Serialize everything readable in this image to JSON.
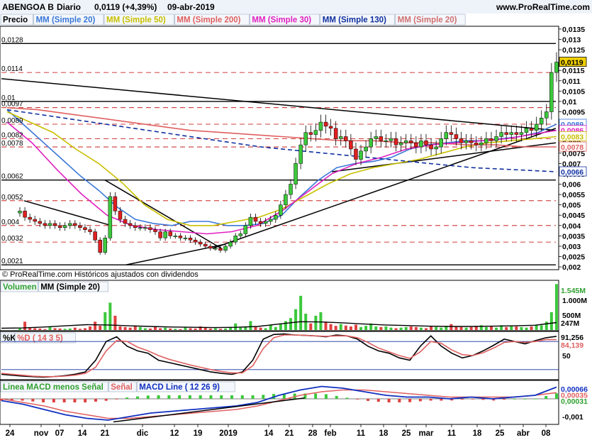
{
  "header": {
    "symbol": "ABENGOA B",
    "period": "Diario",
    "last": "0,0119 (+4,39%)",
    "date": "09-abr-2019",
    "site": "www.ProRealTime.com"
  },
  "main_legend": [
    {
      "label": "Precio",
      "color": "#000000"
    },
    {
      "label": "MM (Simple 20)",
      "color": "#3a78d8"
    },
    {
      "label": "MM (Simple 50)",
      "color": "#c8c000"
    },
    {
      "label": "MM (Simple 200)",
      "color": "#e06060"
    },
    {
      "label": "MM (Simple 30)",
      "color": "#e020c0"
    },
    {
      "label": "MM (Simple 130)",
      "color": "#1030a0"
    },
    {
      "label": "MM (Simple 20)",
      "color": "#d07070"
    }
  ],
  "footer_note": "© ProRealTime.com  Históricos ajustados con dividendos",
  "volume_legend": [
    {
      "label": "Volumen",
      "color": "#30a030"
    },
    {
      "label": "MM (Simple 20)",
      "color": "#000000"
    }
  ],
  "stoch_legend": [
    {
      "label": "%K",
      "color": "#000000"
    },
    {
      "label": "%D ( 14 3 5)",
      "color": "#e06060"
    }
  ],
  "macd_legend": [
    {
      "label": "Linea MACD menos Señal",
      "color": "#30a030"
    },
    {
      "label": "Señal",
      "color": "#e06060"
    },
    {
      "label": "MACD Line ( 12 26 9)",
      "color": "#1030c0"
    }
  ],
  "x_labels": [
    "24",
    "nov",
    "07",
    "14",
    "21",
    "dic",
    "12",
    "19",
    "2019",
    "14",
    "21",
    "28",
    "feb",
    "11",
    "18",
    "25",
    "mar",
    "11",
    "18",
    "25",
    "abr",
    "08"
  ],
  "price_axis_ticks": [
    "0,0135",
    "0,013",
    "0,0125",
    "0,012",
    "0,0115",
    "0,011",
    "0,0105",
    "0,01",
    "0,0095",
    "0,009",
    "0,0085",
    "0,008",
    "0,0075",
    "0,007",
    "0,0065",
    "0,006",
    "0,0055",
    "0,005",
    "0,0045",
    "0,004",
    "0,0035",
    "0,003",
    "0,0025",
    "0,002"
  ],
  "price_left_levels": [
    "0,0128",
    "0,0114",
    "0,01",
    "0,0097",
    "0,0089",
    "0,0082",
    "0,0078",
    "0,0062",
    "0,0052",
    "0,004",
    "0,0032",
    "0,0021"
  ],
  "price_badges": [
    {
      "text": "0,0119",
      "bg": "#f0d000",
      "fg": "#000000"
    },
    {
      "text": "0,0089",
      "bg": "#ffffff",
      "fg": "#3a78d8"
    },
    {
      "text": "0,0086",
      "bg": "#ffffff",
      "fg": "#e020c0"
    },
    {
      "text": "0,0083",
      "bg": "#ffffff",
      "fg": "#c8c000"
    },
    {
      "text": "0,0078",
      "bg": "#ffffff",
      "fg": "#e06060"
    },
    {
      "text": "0,0066",
      "bg": "#ffffff",
      "fg": "#1030a0"
    }
  ],
  "volume_axis": [
    "1.000M",
    "500M"
  ],
  "volume_badges": [
    {
      "text": "1.545M",
      "fg": "#30a030"
    },
    {
      "text": "247M",
      "fg": "#000000"
    }
  ],
  "stoch_axis": [
    "50"
  ],
  "stoch_badges": [
    {
      "text": "91,256",
      "fg": "#000000"
    },
    {
      "text": "84,139",
      "fg": "#e06060"
    }
  ],
  "macd_axis": [
    "-0,001"
  ],
  "macd_badges": [
    {
      "text": "0,00066",
      "fg": "#1030c0"
    },
    {
      "text": "0,00035",
      "fg": "#e06060"
    },
    {
      "text": "0,00031",
      "fg": "#30a030"
    }
  ],
  "chart_data": {
    "type": "candlestick",
    "series": [
      {
        "name": "Precio",
        "close": [
          0.0047,
          0.0044,
          0.0043,
          0.0042,
          0.0041,
          0.004,
          0.0041,
          0.004,
          0.0039,
          0.004,
          0.0041,
          0.004,
          0.0039,
          0.0038,
          0.0037,
          0.0033,
          0.0027,
          0.0034,
          0.0054,
          0.0047,
          0.0043,
          0.0041,
          0.004,
          0.0039,
          0.0039,
          0.0039,
          0.0038,
          0.0037,
          0.0034,
          0.0037,
          0.0035,
          0.0035,
          0.0034,
          0.0034,
          0.0033,
          0.0032,
          0.0031,
          0.003,
          0.0029,
          0.0029,
          0.0028,
          0.003,
          0.0032,
          0.0035,
          0.0036,
          0.004,
          0.0044,
          0.0042,
          0.0041,
          0.0042,
          0.0043,
          0.0045,
          0.005,
          0.0055,
          0.006,
          0.007,
          0.0079,
          0.0085,
          0.0084,
          0.0086,
          0.009,
          0.0088,
          0.0087,
          0.0082,
          0.0083,
          0.0081,
          0.0077,
          0.0072,
          0.0076,
          0.0078,
          0.0082,
          0.0083,
          0.0081,
          0.0081,
          0.0082,
          0.0079,
          0.008,
          0.0081,
          0.008,
          0.0078,
          0.0081,
          0.0079,
          0.0077,
          0.0078,
          0.0082,
          0.0085,
          0.0084,
          0.0082,
          0.008,
          0.0081,
          0.008,
          0.0079,
          0.008,
          0.0082,
          0.0081,
          0.0083,
          0.0085,
          0.0084,
          0.0085,
          0.0084,
          0.0085,
          0.0087,
          0.0086,
          0.0089,
          0.0092,
          0.0095,
          0.0114,
          0.0119
        ]
      },
      {
        "name": "MM (Simple 20)",
        "values": [
          0.0096,
          0.0088,
          0.008,
          0.0072,
          0.0064,
          0.0057,
          0.0049,
          0.0043,
          0.0041,
          0.004,
          0.0042,
          0.0042,
          0.004,
          0.004,
          0.0041,
          0.0045,
          0.0054,
          0.0062,
          0.0068,
          0.007,
          0.0071,
          0.0073,
          0.0077,
          0.0079,
          0.008,
          0.0081,
          0.0081,
          0.0082,
          0.0083,
          0.0085,
          0.0089
        ]
      },
      {
        "name": "MM (Simple 50)",
        "values": [
          0.0095,
          0.009,
          0.0085,
          0.0077,
          0.007,
          0.0061,
          0.005,
          0.0043,
          0.004,
          0.004,
          0.0042,
          0.0044,
          0.0048,
          0.0054,
          0.006,
          0.0065,
          0.0068,
          0.007,
          0.0072,
          0.0075,
          0.0078,
          0.008,
          0.0081,
          0.0082,
          0.0083
        ]
      },
      {
        "name": "MM (Simple 200)",
        "values": [
          0.0097,
          0.0096,
          0.0094,
          0.0092,
          0.009,
          0.0088,
          0.0086,
          0.0085,
          0.0084,
          0.0083,
          0.0082,
          0.0081,
          0.0081,
          0.008,
          0.008,
          0.0079,
          0.0079,
          0.0078,
          0.0078
        ]
      },
      {
        "name": "MM (Simple 30)",
        "values": [
          0.009,
          0.008,
          0.0067,
          0.0055,
          0.0045,
          0.004,
          0.0038,
          0.0037,
          0.0036,
          0.0037,
          0.004,
          0.0047,
          0.0056,
          0.0065,
          0.007,
          0.0073,
          0.0077,
          0.0079,
          0.008,
          0.0081,
          0.0082,
          0.0084,
          0.0086
        ]
      },
      {
        "name": "MM (Simple 130)",
        "values": [
          0.0096,
          0.0093,
          0.009,
          0.0087,
          0.0084,
          0.0081,
          0.0078,
          0.0076,
          0.0074,
          0.0072,
          0.007,
          0.0068,
          0.0067,
          0.0066
        ]
      }
    ],
    "x_labels": [
      "24",
      "nov",
      "07",
      "14",
      "21",
      "dic",
      "12",
      "19",
      "2019",
      "14",
      "21",
      "28",
      "feb",
      "11",
      "18",
      "25",
      "mar",
      "11",
      "18",
      "25",
      "abr",
      "08"
    ],
    "ylim": [
      0.0019,
      0.0136
    ],
    "volume": [
      0.05,
      0.28,
      0.08,
      0.06,
      0.05,
      0.03,
      0.12,
      0.06,
      0.05,
      0.04,
      0.05,
      0.08,
      0.04,
      0.06,
      0.12,
      0.28,
      0.14,
      0.6,
      0.92,
      0.48,
      0.12,
      0.1,
      0.08,
      0.15,
      0.1,
      0.06,
      0.05,
      0.12,
      0.06,
      0.08,
      0.05,
      0.04,
      0.03,
      0.1,
      0.06,
      0.05,
      0.12,
      0.08,
      0.05,
      0.06,
      0.04,
      0.05,
      0.1,
      0.22,
      0.08,
      0.1,
      0.3,
      0.12,
      0.08,
      0.06,
      0.18,
      0.1,
      0.22,
      0.3,
      0.4,
      0.7,
      1.15,
      0.55,
      0.22,
      0.48,
      0.6,
      0.28,
      0.2,
      0.14,
      0.2,
      0.15,
      0.12,
      0.18,
      0.1,
      0.14,
      0.22,
      0.12,
      0.1,
      0.12,
      0.08,
      0.06,
      0.08,
      0.1,
      0.12,
      0.1,
      0.08,
      0.06,
      0.12,
      0.1,
      0.08,
      0.14,
      0.2,
      0.12,
      0.1,
      0.08,
      0.1,
      0.14,
      0.16,
      0.1,
      0.12,
      0.08,
      0.16,
      0.1,
      0.14,
      0.12,
      0.1,
      0.08,
      0.12,
      0.18,
      0.16,
      0.28,
      0.6,
      1.545
    ],
    "volume_ma_last": 0.247,
    "stochastic": {
      "k_last": 91.256,
      "d_last": 84.139
    },
    "macd": {
      "macd_last": 0.00066,
      "signal_last": 0.00035,
      "hist_last": 0.00031
    }
  }
}
